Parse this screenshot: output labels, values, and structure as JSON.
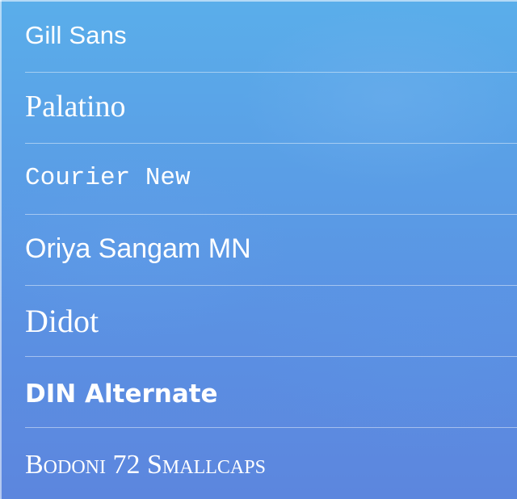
{
  "font_list": {
    "items": [
      {
        "label": "Gill Sans"
      },
      {
        "label": "Palatino"
      },
      {
        "label": "Courier New"
      },
      {
        "label": "Oriya Sangam MN"
      },
      {
        "label": "Didot"
      },
      {
        "label": "DIN Alternate"
      },
      {
        "label": "Bodoni 72 Smallcaps"
      }
    ]
  },
  "colors": {
    "text": "#ffffff",
    "background_top": "#5aaeea",
    "background_bottom": "#5c86de",
    "separator": "#c9def7"
  }
}
